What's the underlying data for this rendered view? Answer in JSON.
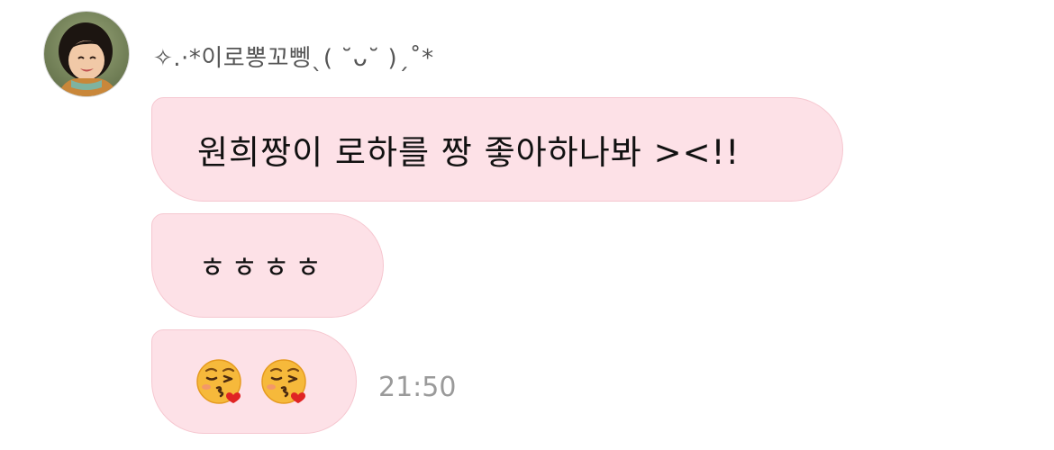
{
  "chat": {
    "sender": {
      "name": "✧.·*이로뽕꼬뼁ˎ( ˘ᴗ˘ )ˏ˚*",
      "avatar_icon": "profile-photo-child"
    },
    "messages": [
      {
        "text": "원희짱이 로하를 짱 좋아하나봐 ><!!"
      },
      {
        "text": "ㅎㅎㅎㅎ"
      },
      {
        "emoji": [
          "kissing-face-with-heart",
          "kissing-face-with-heart"
        ]
      }
    ],
    "timestamp": "21:50"
  },
  "colors": {
    "bubble_background": "#fde1e7",
    "bubble_border": "#f6c7d0",
    "timestamp": "#9a9a9a",
    "sender_name": "#555555"
  }
}
